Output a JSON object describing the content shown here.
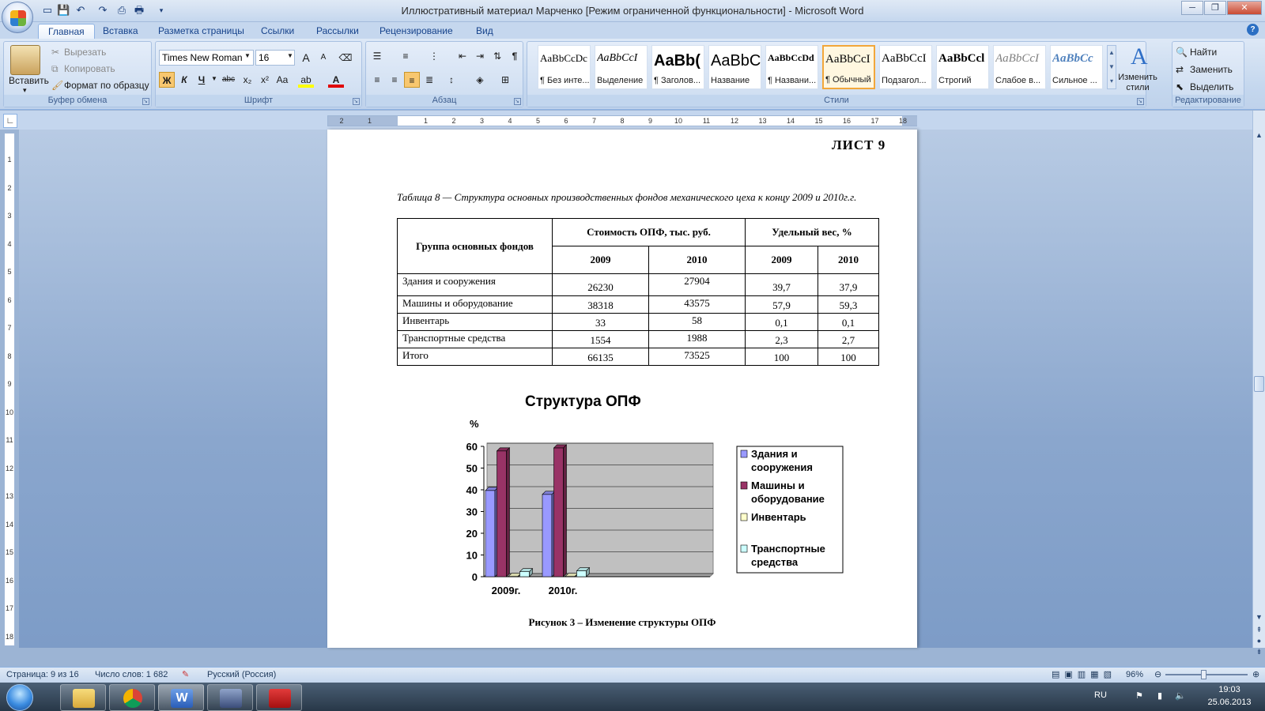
{
  "app": {
    "title": "Иллюстративный материал Марченко [Режим ограниченной функциональности] - Microsoft Word",
    "window_buttons": {
      "minimize": "─",
      "maximize": "❐",
      "close": "✕"
    }
  },
  "quick_access": [
    "new-doc-icon",
    "save-icon",
    "undo-icon",
    "redo-icon",
    "print-preview-icon",
    "print-icon"
  ],
  "tabs": [
    {
      "label": "Главная"
    },
    {
      "label": "Вставка"
    },
    {
      "label": "Разметка страницы"
    },
    {
      "label": "Ссылки"
    },
    {
      "label": "Рассылки"
    },
    {
      "label": "Рецензирование"
    },
    {
      "label": "Вид"
    }
  ],
  "ribbon": {
    "clipboard": {
      "label": "Буфер обмена",
      "paste": "Вставить",
      "cut": "Вырезать",
      "copy": "Копировать",
      "format_painter": "Формат по образцу"
    },
    "font": {
      "label": "Шрифт",
      "font_name": "Times New Roman",
      "font_size": "16",
      "bold": "Ж",
      "italic": "К",
      "underline": "Ч",
      "strike": "abc",
      "subscript": "x₂",
      "superscript": "x²",
      "case": "Aa",
      "grow": "A",
      "shrink": "A",
      "highlight": "ab",
      "color": "A"
    },
    "paragraph": {
      "label": "Абзац",
      "pilcrow": "¶"
    },
    "styles": {
      "label": "Стили",
      "items": [
        {
          "preview": "AaBbCcDc",
          "name": "¶ Без инте..."
        },
        {
          "preview": "AaBbCcI",
          "name": "Выделение"
        },
        {
          "preview": "AaBb(",
          "name": "¶ Заголов..."
        },
        {
          "preview": "AaBbC",
          "name": "Название"
        },
        {
          "preview": "AaBbCcDd",
          "name": "¶ Названи..."
        },
        {
          "preview": "AaBbCcI",
          "name": "¶ Обычный"
        },
        {
          "preview": "AaBbCcI",
          "name": "Подзагол..."
        },
        {
          "preview": "AaBbCcl",
          "name": "Строгий"
        },
        {
          "preview": "AaBbCcI",
          "name": "Слабое в..."
        },
        {
          "preview": "AaBbCc",
          "name": "Сильное ..."
        }
      ],
      "change_styles": "Изменить стили"
    },
    "editing": {
      "label": "Редактирование",
      "find": "Найти",
      "replace": "Заменить",
      "select": "Выделить"
    }
  },
  "ruler": {
    "marks": [
      "2",
      "1",
      "1",
      "2",
      "3",
      "4",
      "5",
      "6",
      "7",
      "8",
      "9",
      "10",
      "11",
      "12",
      "13",
      "14",
      "15",
      "16",
      "17",
      "18"
    ],
    "vmarks": [
      "1",
      "2",
      "3",
      "4",
      "5",
      "6",
      "7",
      "8",
      "9",
      "10",
      "11",
      "12",
      "13",
      "14",
      "15",
      "16",
      "17",
      "18"
    ]
  },
  "document": {
    "sheet_label": "ЛИСТ  9",
    "table_caption": "Таблица 8 — Структура основных производственных фондов механического цеха к концу 2009 и 2010г.г.",
    "table": {
      "group_header": "Группа основных фондов",
      "cost_header": "Стоимость ОПФ, тыс. руб.",
      "share_header": "Удельный вес, %",
      "years": [
        "2009",
        "2010",
        "2009",
        "2010"
      ],
      "rows": [
        {
          "name": "Здания и сооружения",
          "c2009": "26230",
          "c2010": "27904",
          "s2009": "39,7",
          "s2010": "37,9"
        },
        {
          "name": "Машины и оборудование",
          "c2009": "38318",
          "c2010": "43575",
          "s2009": "57,9",
          "s2010": "59,3"
        },
        {
          "name": "Инвентарь",
          "c2009": "33",
          "c2010": "58",
          "s2009": "0,1",
          "s2010": "0,1"
        },
        {
          "name": "Транспортные средства",
          "c2009": "1554",
          "c2010": "1988",
          "s2009": "2,3",
          "s2010": "2,7"
        },
        {
          "name": "Итого",
          "c2009": "66135",
          "c2010": "73525",
          "s2009": "100",
          "s2010": "100"
        }
      ]
    },
    "figure_caption": "Рисунок 3 – Изменение структуры ОПФ"
  },
  "chart_data": {
    "type": "bar",
    "title": "Структура ОПФ",
    "ylabel": "%",
    "xlabel": "",
    "categories": [
      "2009г.",
      "2010г."
    ],
    "series": [
      {
        "name": "Здания и сооружения",
        "values": [
          39.7,
          37.9
        ],
        "color": "#9999ff"
      },
      {
        "name": "Машины и оборудование",
        "values": [
          57.9,
          59.3
        ],
        "color": "#993366"
      },
      {
        "name": "Инвентарь",
        "values": [
          0.1,
          0.1
        ],
        "color": "#ffffcc"
      },
      {
        "name": "Транспортные средства",
        "values": [
          2.3,
          2.7
        ],
        "color": "#ccffff"
      }
    ],
    "ylim": [
      0,
      60
    ],
    "yticks": [
      "0",
      "10",
      "20",
      "30",
      "40",
      "50",
      "60"
    ],
    "grid": true,
    "legend": "right",
    "plot_bg": "#c0c0c0"
  },
  "status": {
    "page": "Страница: 9 из 16",
    "words": "Число слов: 1 682",
    "language": "Русский (Россия)",
    "zoom": "96%",
    "zoom_level": 0.46
  },
  "taskbar": {
    "apps": [
      "explorer-icon",
      "chrome-icon",
      "word-icon",
      "app-icon",
      "acrobat-icon"
    ],
    "lang": "RU",
    "time": "19:03",
    "date": "25.06.2013"
  }
}
